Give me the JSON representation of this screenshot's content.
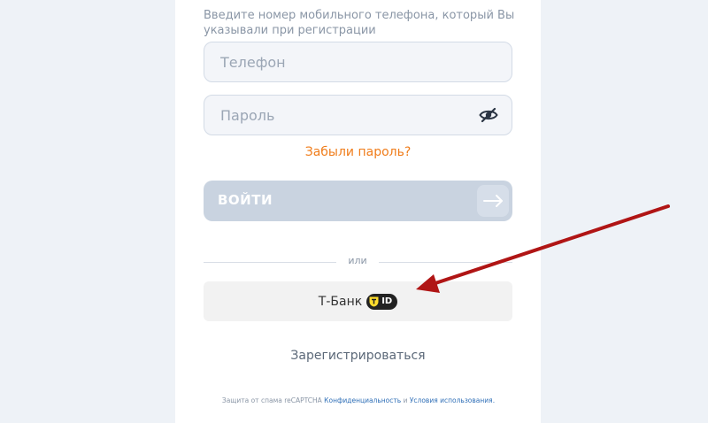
{
  "form": {
    "hint": "Введите номер мобильного телефона, который Вы указывали при регистрации",
    "phone_placeholder": "Телефон",
    "password_placeholder": "Пароль",
    "forgot_label": "Забыли пароль?",
    "login_label": "ВОЙТИ",
    "or_label": "или",
    "tbank_label": "Т-Банк",
    "tbank_badge": "ID",
    "register_label": "Зарегистрироваться"
  },
  "legal": {
    "prefix": "Защита от спама reCAPTCHA",
    "privacy_link": "Конфиденциальность",
    "conjunction": "и",
    "terms_link": "Условия использования."
  },
  "icons": {
    "password_toggle": "eye-slash-icon",
    "login_arrow": "arrow-right-icon",
    "tbank_logo": "tbank-shield-icon",
    "annotation": "red-arrow-annotation"
  },
  "colors": {
    "accent_orange": "#f07d1b",
    "link_blue": "#2f6fb7",
    "disabled_button": "#c9d3e0",
    "tbank_button": "#f2f2f2",
    "annotation_red": "#b01515"
  }
}
